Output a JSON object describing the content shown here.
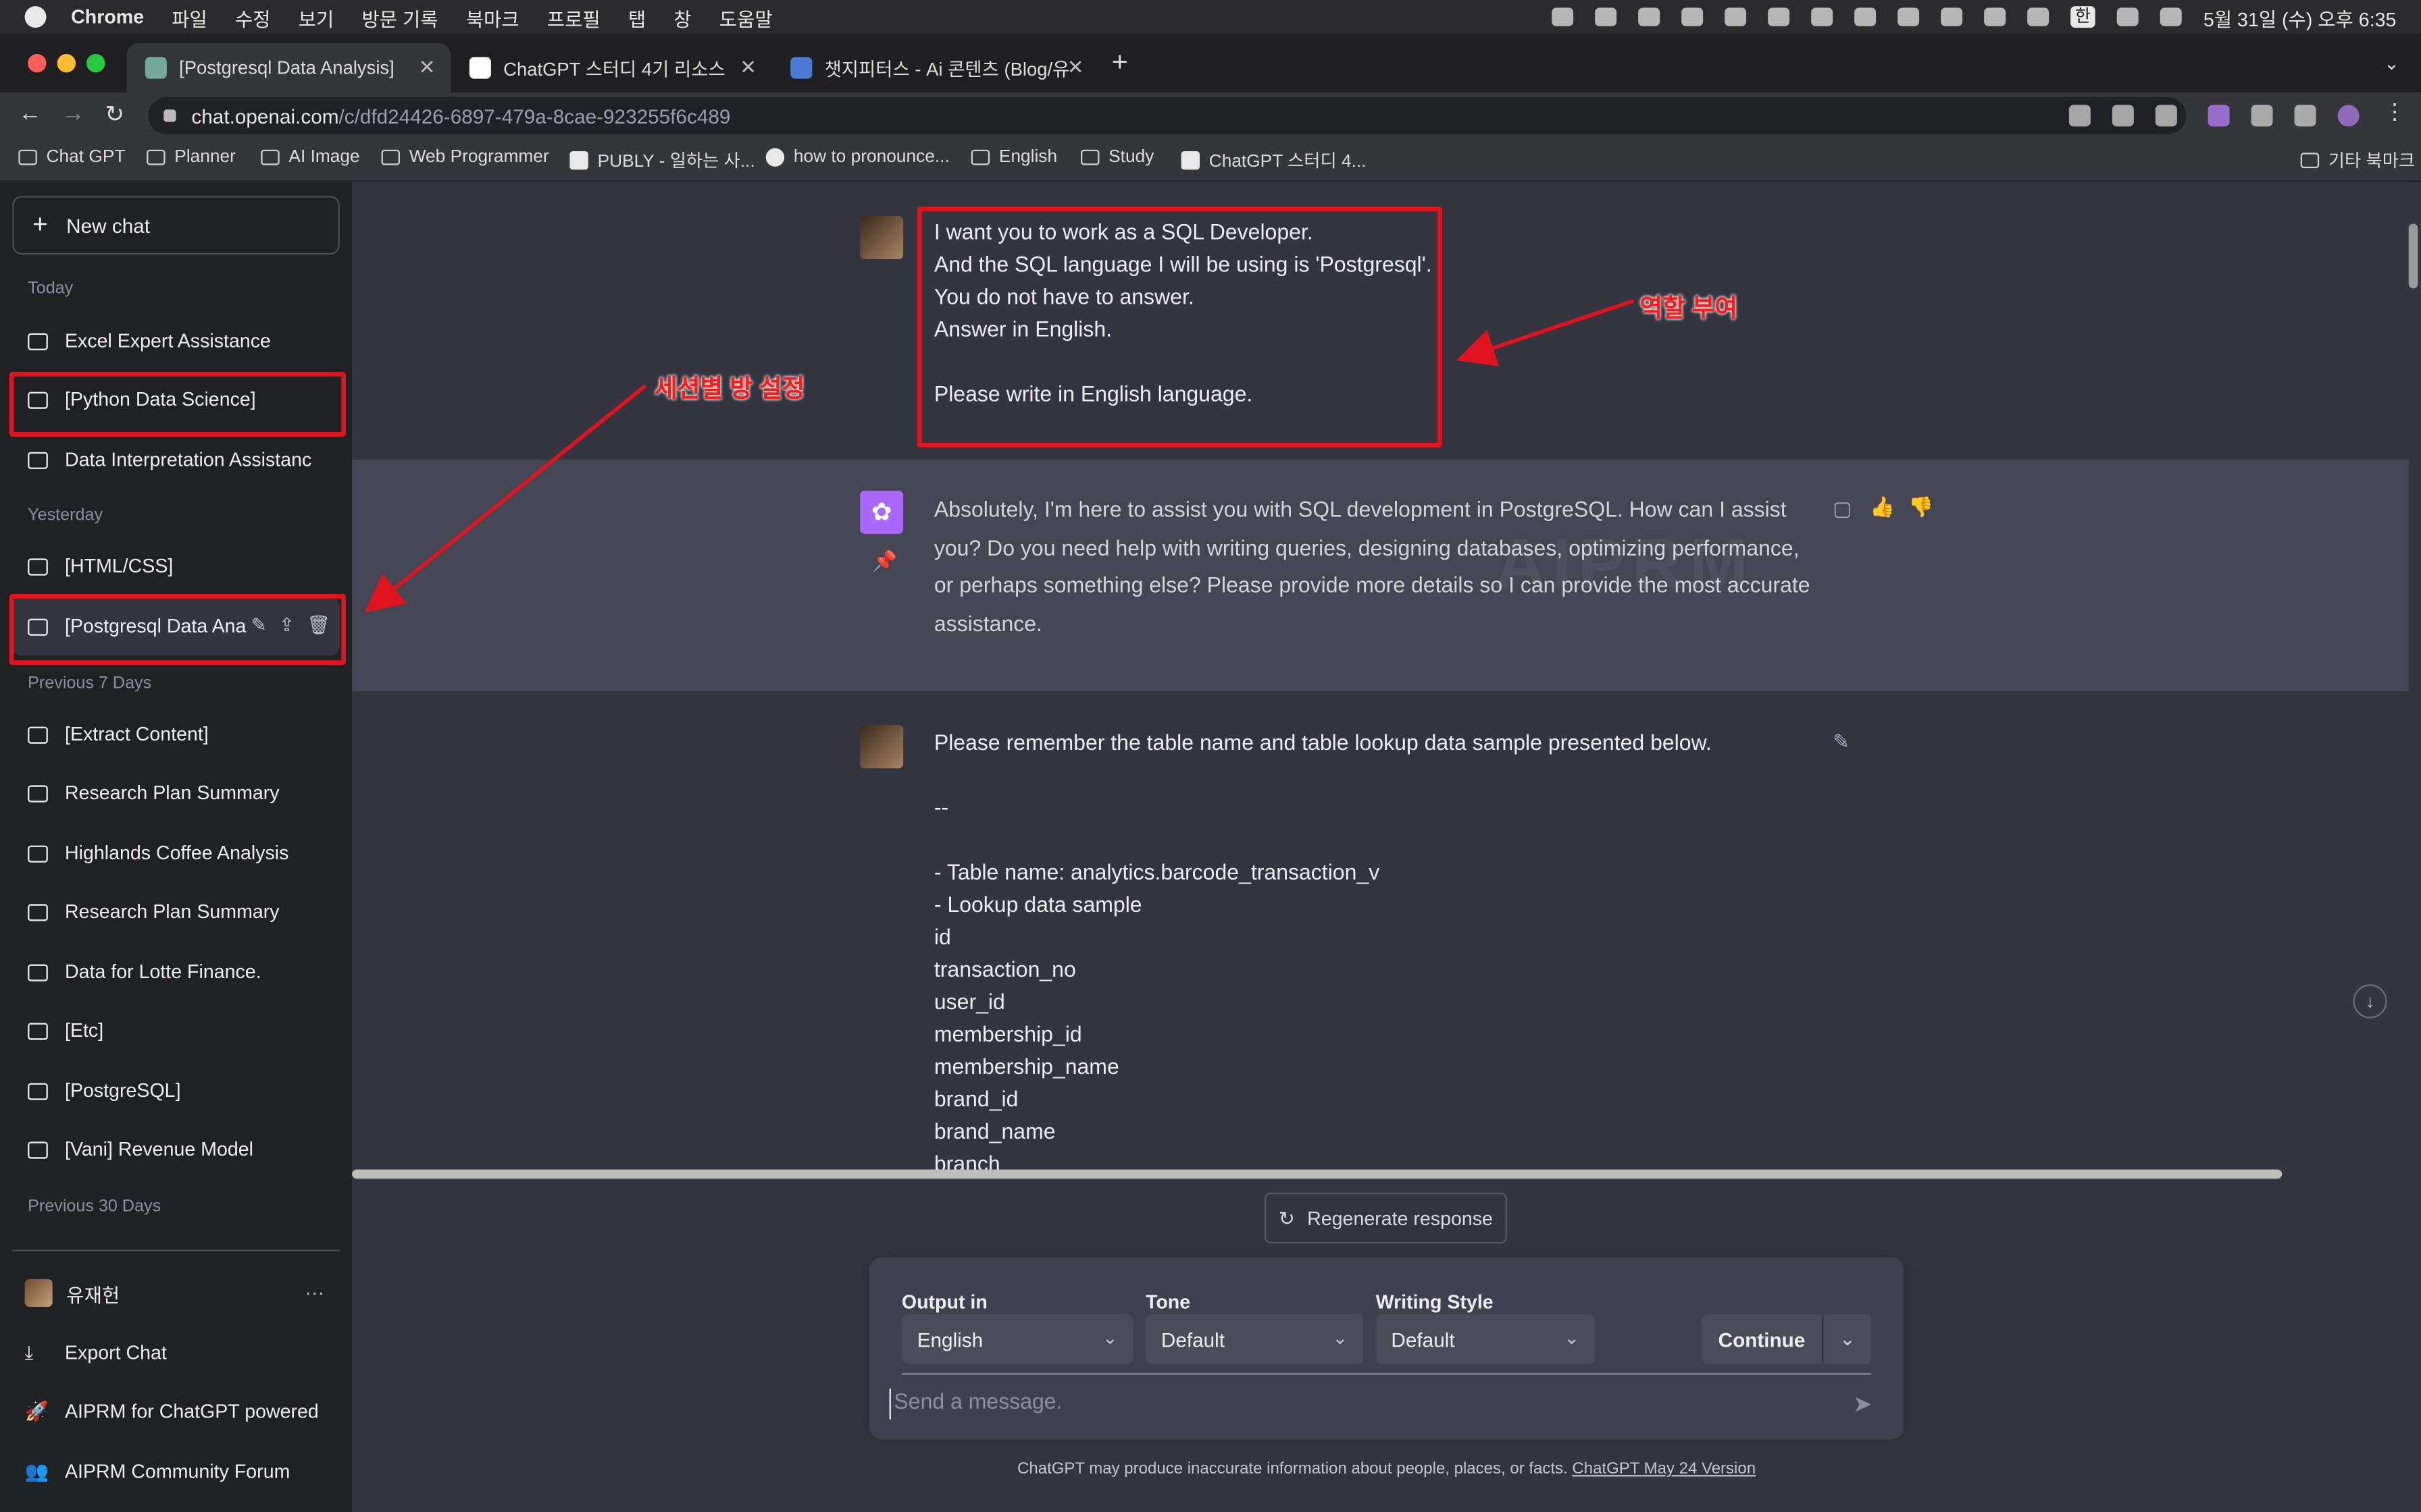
{
  "menubar": {
    "app": "Chrome",
    "items": [
      "파일",
      "수정",
      "보기",
      "방문 기록",
      "북마크",
      "프로필",
      "탭",
      "창",
      "도움말"
    ],
    "ime": "한",
    "clock": "5월 31일 (수) 오후 6:35"
  },
  "tabs": [
    {
      "title": "[Postgresql Data Analysis]",
      "active": true,
      "color": "#74aa9c"
    },
    {
      "title": "ChatGPT 스터디 4기 리소스",
      "active": false,
      "color": "#ffffff"
    },
    {
      "title": "챗지피터스 - Ai 콘텐츠 (Blog/유튜",
      "active": false,
      "color": "#4a7bd6"
    }
  ],
  "omnibox": {
    "domain": "chat.openai.com",
    "path": "/c/dfd24426-6897-479a-8cae-923255f6c489"
  },
  "bookmarks": [
    "Chat GPT",
    "Planner",
    "AI Image",
    "Web Programmer",
    "PUBLY - 일하는 사...",
    "how to pronounce...",
    "English",
    "Study",
    "ChatGPT 스터디 4...",
    "기타 북마크"
  ],
  "sidebar": {
    "new_chat": "New chat",
    "sections": {
      "today": "Today",
      "yesterday": "Yesterday",
      "prev7": "Previous 7 Days",
      "prev30": "Previous 30 Days"
    },
    "items": [
      "Excel Expert Assistance",
      "[Python Data Science]",
      "Data Interpretation Assistanc",
      "[HTML/CSS]",
      "[Postgresql Data Ana",
      "[Extract Content]",
      "Research Plan Summary",
      "Highlands Coffee Analysis",
      "Research Plan Summary",
      "Data for Lotte Finance.",
      "[Etc]",
      "[PostgreSQL]",
      "[Vani] Revenue Model"
    ],
    "user": "유재헌",
    "more": "···",
    "export": "Export Chat",
    "aiprm": "AIPRM for ChatGPT powered",
    "forum": "AIPRM Community Forum"
  },
  "messages": {
    "user1": "I want you to work as a SQL Developer.\nAnd the SQL language I will be using is 'Postgresql'.\nYou do not have to answer.\nAnswer in English.\n\nPlease write in English language.",
    "bot1": "Absolutely, I'm here to assist you with SQL development in PostgreSQL. How can I assist you? Do you need help with writing queries, designing databases, optimizing performance, or perhaps something else? Please provide more details so I can provide the most accurate assistance.",
    "user2": "Please remember the table name and table lookup data sample presented below.\n\n--\n\n- Table name: analytics.barcode_transaction_v\n- Lookup data sample\nid\ntransaction_no\nuser_id\nmembership_id\nmembership_name\nbrand_id\nbrand_name\nbranch"
  },
  "watermark": "AIPRM",
  "annotations": {
    "role": "역할 부여",
    "session": "세션별 방 설정"
  },
  "regenerate": "Regenerate response",
  "composer": {
    "output_label": "Output in",
    "output_value": "English",
    "tone_label": "Tone",
    "tone_value": "Default",
    "style_label": "Writing Style",
    "style_value": "Default",
    "continue": "Continue",
    "placeholder": "Send a message."
  },
  "disclaimer": {
    "text": "ChatGPT may produce inaccurate information about people, places, or facts. ",
    "link": "ChatGPT May 24 Version"
  },
  "colors": {
    "sidebar": "#202123",
    "main": "#343541",
    "bot_bg": "#444654",
    "annotation": "#e0141e"
  }
}
